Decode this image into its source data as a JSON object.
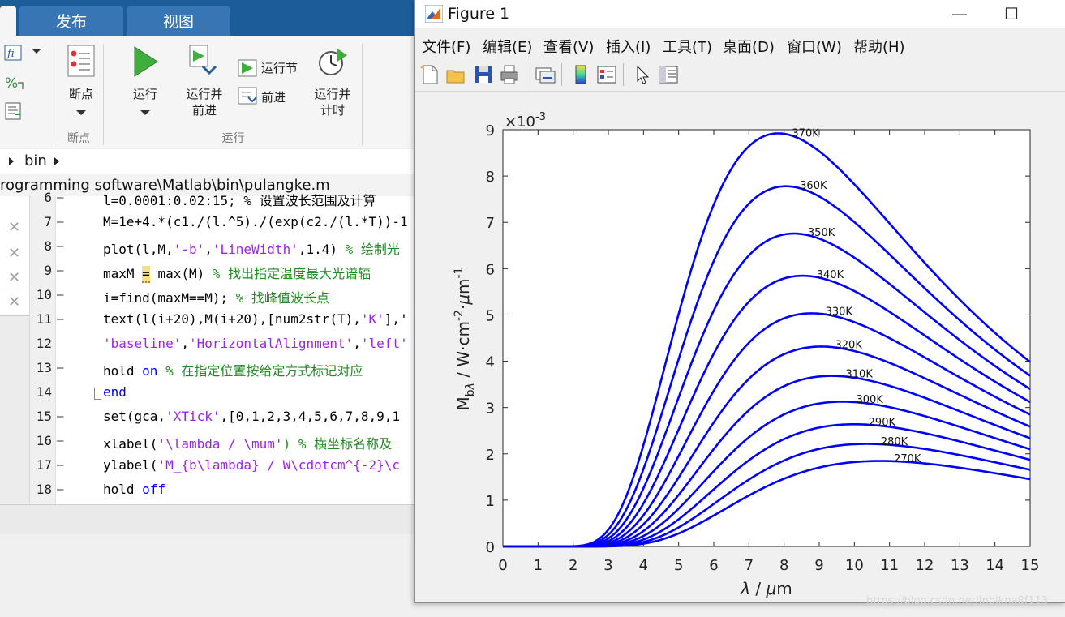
{
  "ribbon": {
    "tabs": [
      "发布",
      "视图"
    ],
    "breakpoints_label": "断点",
    "breakpoints_group": "断点",
    "run_label": "运行",
    "run_advance_label": "运行并\n前进",
    "run_section_label": "运行节",
    "advance_label": "前进",
    "run_time_label": "运行并\n计时",
    "run_group": "运行"
  },
  "breadcrumb": {
    "item": "bin"
  },
  "path": "rogramming software\\Matlab\\bin\\pulangke.m",
  "code_lines": [
    {
      "n": "6"
    },
    {
      "n": "7"
    },
    {
      "n": "8"
    },
    {
      "n": "9"
    },
    {
      "n": "10"
    },
    {
      "n": "11"
    },
    {
      "n": "12"
    },
    {
      "n": "13"
    },
    {
      "n": "14"
    },
    {
      "n": "15"
    },
    {
      "n": "16"
    },
    {
      "n": "17"
    },
    {
      "n": "18"
    }
  ],
  "code": {
    "l6": "l=0.0001:0.02:15; % 设置波长范围及计算",
    "l7": "M=1e+4.*(c1./(l.^5)./(exp(c2./(l.*T))-1",
    "l8a": "plot(l,M,",
    "l8b": "'-b'",
    "l8c": ",",
    "l8d": "'LineWidth'",
    "l8e": ",1.4) ",
    "l8f": "% 绘制光",
    "l9a": "maxM ",
    "l9b": "=",
    "l9c": " max(M) ",
    "l9d": "% 找出指定温度最大光谱辐",
    "l10a": "i=find(maxM==M); ",
    "l10b": "% 找峰值波长点",
    "l11a": "text(l(i+20),M(i+20),[num2str(T),",
    "l11b": "'K'",
    "l11c": "],'",
    "l12a": "'baseline'",
    "l12b": ",",
    "l12c": "'HorizontalAlignment'",
    "l12d": ",",
    "l12e": "'left'",
    "l13a": "hold ",
    "l13b": "on",
    "l13c": " % 在指定位置按给定方式标记对应",
    "l14": "end",
    "l15a": "set(gca,",
    "l15b": "'XTick'",
    "l15c": ",[0,1,2,3,4,5,6,7,8,9,1",
    "l16a": "xlabel(",
    "l16b": "'\\lambda / \\mum'",
    "l16c": ") % 横坐标名称及",
    "l17a": "ylabel(",
    "l17b": "'M_{b\\lambda} / W\\cdotcm^{-2}\\c",
    "l18a": "hold ",
    "l18b": "off"
  },
  "figure": {
    "title": "Figure 1",
    "menu": [
      "文件(F)",
      "编辑(E)",
      "查看(V)",
      "插入(I)",
      "工具(T)",
      "桌面(D)",
      "窗口(W)",
      "帮助(H)"
    ],
    "toolbar_icons": [
      "new-file-icon",
      "open-folder-icon",
      "save-icon",
      "print-icon",
      "link-plot-icon",
      "colorbar-icon",
      "legend-icon",
      "pointer-icon",
      "property-editor-icon"
    ]
  },
  "chart_data": {
    "type": "line",
    "xlabel": "λ / μm",
    "ylabel": "M_bλ / W·cm^-2·μm^-1",
    "exponent": "×10^-3",
    "xlim": [
      0,
      15
    ],
    "ylim": [
      0,
      0.009
    ],
    "xticks": [
      0,
      1,
      2,
      3,
      4,
      5,
      6,
      7,
      8,
      9,
      10,
      11,
      12,
      13,
      14,
      15
    ],
    "yticks": [
      0,
      1,
      2,
      3,
      4,
      5,
      6,
      7,
      8,
      9
    ],
    "series_color": "#0000ff",
    "series": [
      {
        "label": "270K",
        "T": 270
      },
      {
        "label": "280K",
        "T": 280
      },
      {
        "label": "290K",
        "T": 290
      },
      {
        "label": "300K",
        "T": 300
      },
      {
        "label": "310K",
        "T": 310
      },
      {
        "label": "320K",
        "T": 320
      },
      {
        "label": "330K",
        "T": 330
      },
      {
        "label": "340K",
        "T": 340
      },
      {
        "label": "350K",
        "T": 350
      },
      {
        "label": "360K",
        "T": 360
      },
      {
        "label": "370K",
        "T": 370
      }
    ]
  },
  "watermark": "https://blog.csdn.net/jnbikna8f113"
}
